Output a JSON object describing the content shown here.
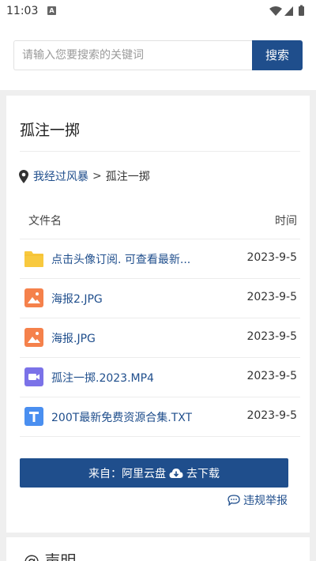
{
  "status": {
    "time": "11:03",
    "notif_badge": "A"
  },
  "search": {
    "placeholder": "请输入您要搜索的关键词",
    "button": "搜索"
  },
  "title": "孤注一掷",
  "breadcrumb": {
    "parent": "我经过风暴",
    "separator": ">",
    "current": "孤注一掷"
  },
  "table": {
    "headers": {
      "name": "文件名",
      "time": "时间"
    },
    "rows": [
      {
        "name": "点击头像订阅. 可查看最新...",
        "date": "2023-9-5",
        "icon": "folder-icon"
      },
      {
        "name": "海报2.JPG",
        "date": "2023-9-5",
        "icon": "image-file-icon"
      },
      {
        "name": "海报.JPG",
        "date": "2023-9-5",
        "icon": "image-file-icon"
      },
      {
        "name": "孤注一掷.2023.MP4",
        "date": "2023-9-5",
        "icon": "video-file-icon"
      },
      {
        "name": "200T最新免费资源合集.TXT",
        "date": "2023-9-5",
        "icon": "text-file-icon"
      }
    ]
  },
  "download": {
    "prefix": "来自：阿里云盘",
    "action": "去下载"
  },
  "report": "违规举报",
  "notice_title": "@ 声明",
  "colors": {
    "accent": "#1f4e8c",
    "folder": "#f8c93e",
    "image": "#f5814b",
    "video": "#7b72e8",
    "text": "#4a8ff0"
  }
}
